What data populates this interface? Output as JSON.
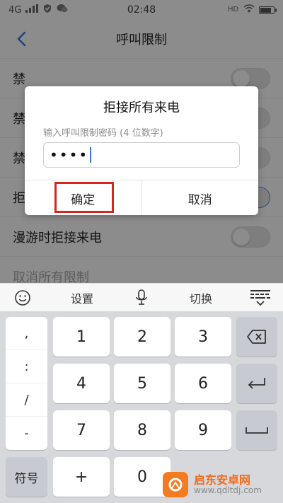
{
  "status_bar": {
    "network": "4G",
    "time": "02:48"
  },
  "header": {
    "title": "呼叫限制"
  },
  "settings": {
    "rows": [
      {
        "label": "禁"
      },
      {
        "label": "禁"
      },
      {
        "label": "禁"
      },
      {
        "label": "拒"
      },
      {
        "label": "漫游时拒接来电"
      },
      {
        "label": "取消所有限制"
      }
    ]
  },
  "dialog": {
    "title": "拒接所有来电",
    "hint": "输入呼叫限制密码 (4 位数字)",
    "password_masked": "••••",
    "confirm_label": "确定",
    "cancel_label": "取消"
  },
  "keyboard_toolbar": {
    "settings_label": "设置",
    "switch_label": "切换"
  },
  "keyboard": {
    "punct": [
      ",",
      ":",
      "/",
      "-"
    ],
    "digits": [
      "1",
      "2",
      "3",
      "4",
      "5",
      "6",
      "7",
      "8",
      "9",
      "0"
    ],
    "symbols_label": "符号",
    "plus_label": "+"
  },
  "colors": {
    "accent": "#3a73e5",
    "highlight": "#d7261f",
    "watermark": "#f47b20"
  },
  "watermark": {
    "line1": "启东安卓网",
    "line2": "www.qdltdj.com"
  }
}
